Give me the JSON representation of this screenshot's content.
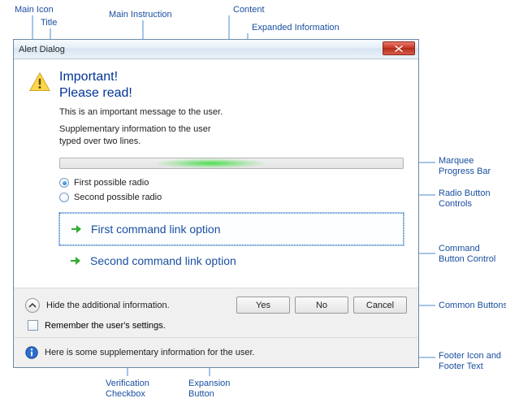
{
  "callouts": {
    "main_icon": "Main Icon",
    "title": "Title",
    "main_instruction": "Main Instruction",
    "content": "Content",
    "expanded_information": "Expanded Information",
    "marquee_progress_bar": "Marquee\nProgress Bar",
    "radio_button_controls": "Radio Button\nControls",
    "command_button_control": "Command\nButton Control",
    "common_buttons": "Common Buttons",
    "footer_icon_text": "Footer Icon and\nFooter Text",
    "verification_checkbox": "Verification\nCheckbox",
    "expansion_button": "Expansion\nButton"
  },
  "dialog": {
    "title": "Alert Dialog",
    "instruction_line1": "Important!",
    "instruction_line2": "Please read!",
    "content_line1": "This is an important message to the user.",
    "content_line2": "Supplementary information to the user",
    "content_line3": "typed over two lines.",
    "radios": [
      {
        "label": "First possible radio",
        "checked": true
      },
      {
        "label": "Second possible radio",
        "checked": false
      }
    ],
    "cmdlinks": [
      {
        "label": "First command link option",
        "selected": true
      },
      {
        "label": "Second command link option",
        "selected": false
      }
    ],
    "expand_label": "Hide the additional information.",
    "verify_label": "Remember the user's settings.",
    "buttons": {
      "yes": "Yes",
      "no": "No",
      "cancel": "Cancel"
    },
    "footer_text": "Here is some supplementary information for the user."
  }
}
